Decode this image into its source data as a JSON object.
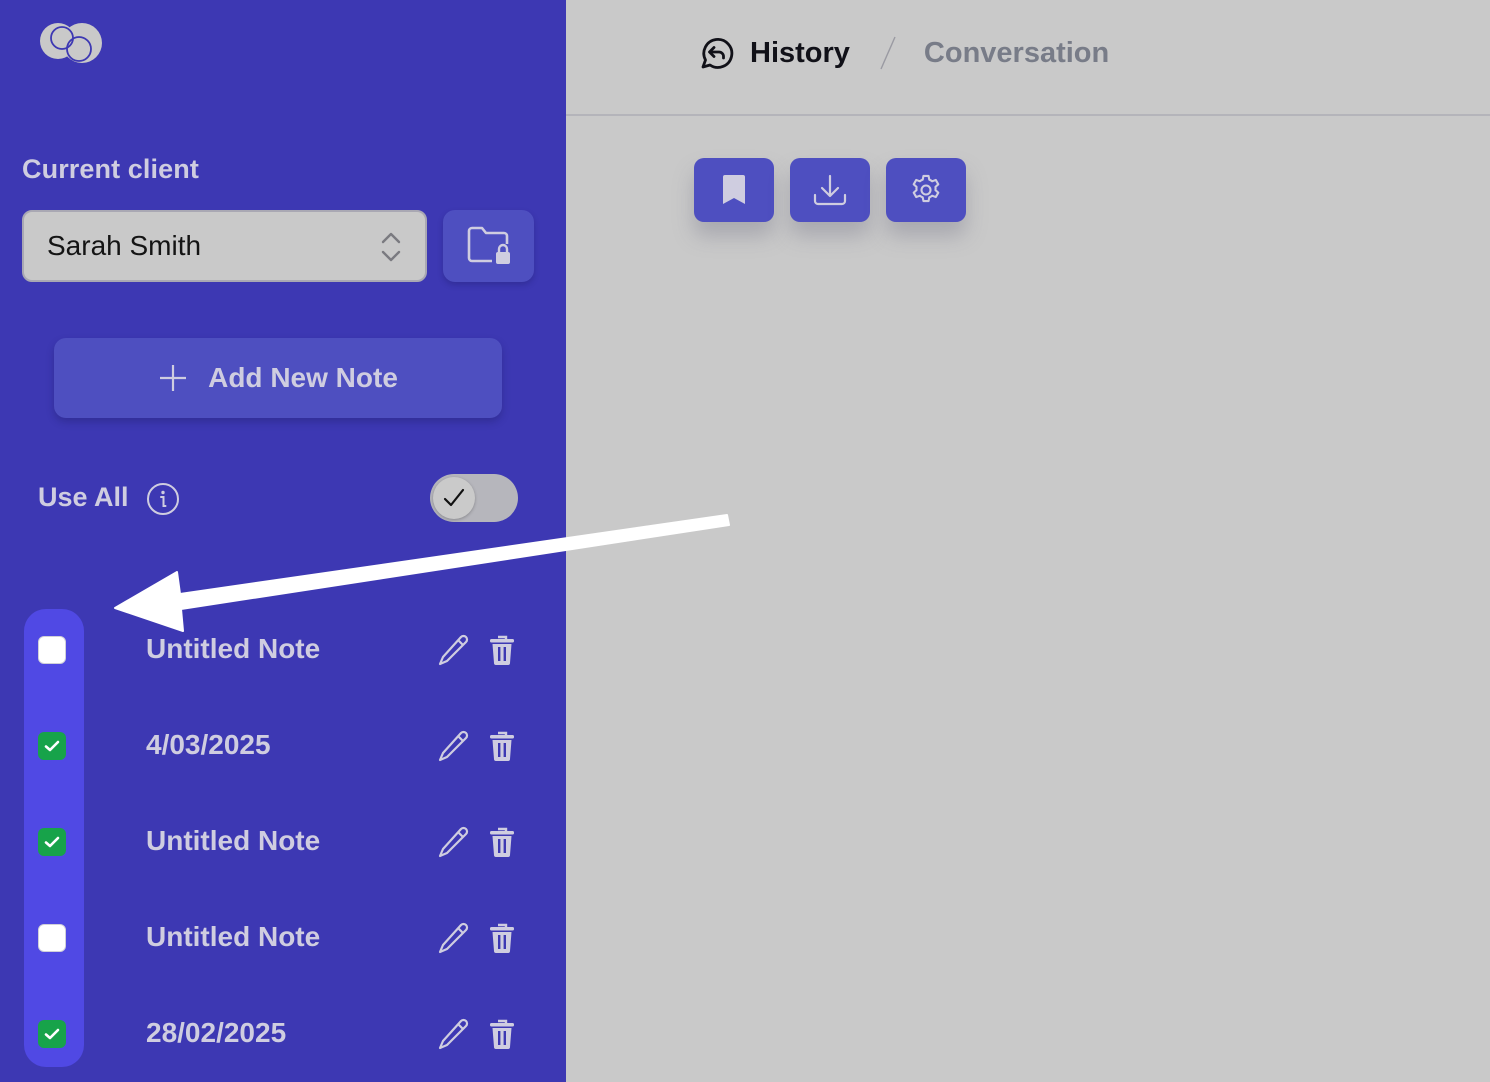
{
  "sidebar": {
    "logo_icon": "overlapping-circles-logo",
    "client_label": "Current client",
    "client_select": {
      "value": "Sarah Smith",
      "icon": "chevron-up-down-icon"
    },
    "folder_lock_button_icon": "folder-lock-icon",
    "add_note_button": {
      "label": "Add New Note",
      "icon": "plus-icon"
    },
    "use_all": {
      "label": "Use All",
      "info_icon": "info-icon",
      "toggle_on": false,
      "knob_icon": "check-icon"
    },
    "notes": [
      {
        "title": "Untitled Note",
        "checked": false
      },
      {
        "title": "4/03/2025",
        "checked": true
      },
      {
        "title": "Untitled Note",
        "checked": true
      },
      {
        "title": "Untitled Note",
        "checked": false
      },
      {
        "title": "28/02/2025",
        "checked": true
      }
    ],
    "note_actions": {
      "edit_icon": "pencil-icon",
      "delete_icon": "trash-icon"
    }
  },
  "header": {
    "breadcrumb": [
      {
        "label": "History",
        "icon": "chat-history-icon",
        "active": true
      },
      {
        "label": "Conversation",
        "active": false
      }
    ],
    "separator": "/"
  },
  "toolbar": {
    "buttons": [
      {
        "name": "bookmark",
        "icon": "bookmark-icon"
      },
      {
        "name": "download",
        "icon": "download-icon"
      },
      {
        "name": "settings",
        "icon": "gear-icon"
      }
    ]
  },
  "colors": {
    "sidebar_bg": "#3d38b3",
    "button_bg": "#4e4fc0",
    "checkbox_rail": "#5049e4",
    "checked_green": "#17a34a",
    "main_bg": "#c9c9c9",
    "sidebar_text": "#cfcde0"
  },
  "annotation": {
    "type": "arrow",
    "color": "#ffffff",
    "points_to": "note-checkbox-rail"
  }
}
